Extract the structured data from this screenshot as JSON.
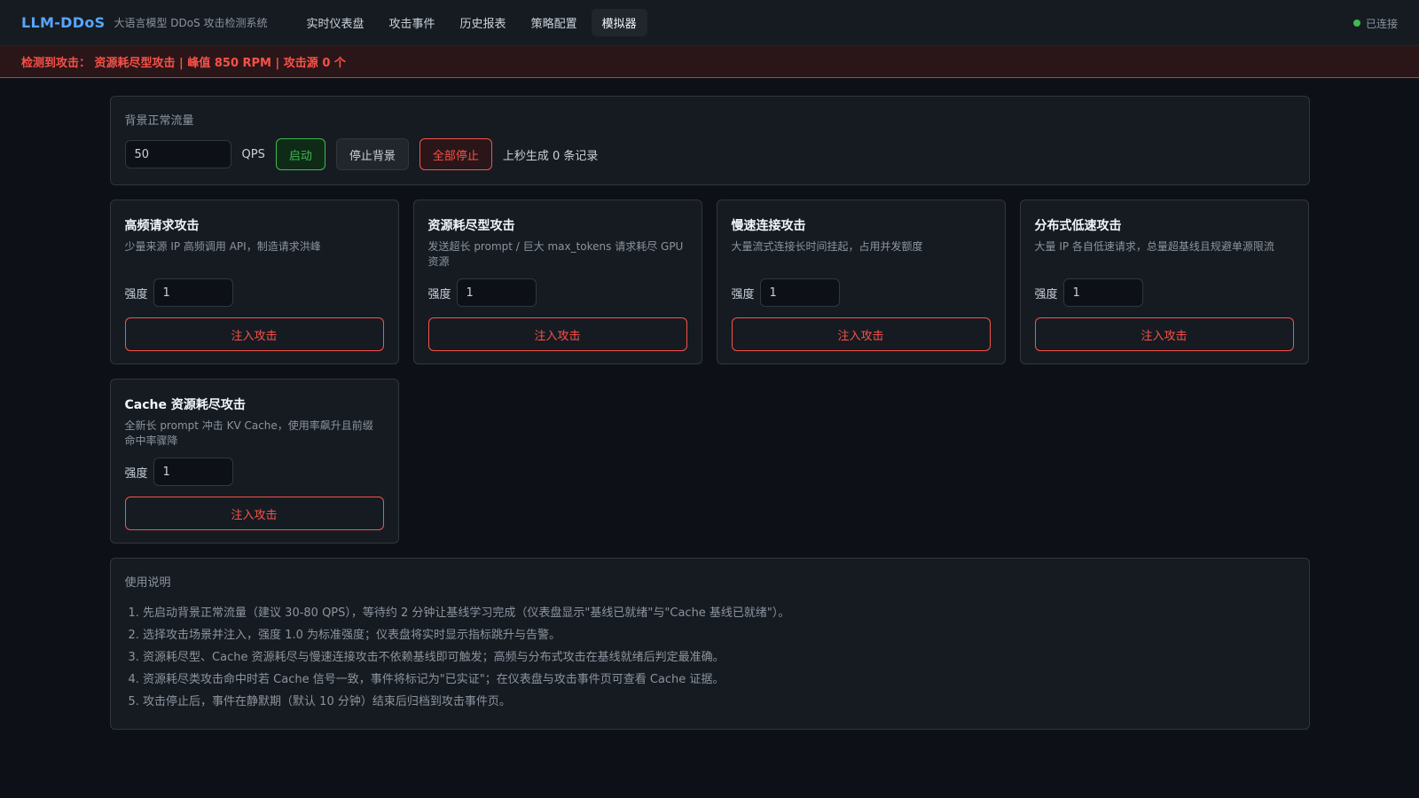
{
  "header": {
    "brand": "LLM-DDoS",
    "subtitle": "大语言模型 DDoS 攻击检测系统",
    "nav": [
      {
        "label": "实时仪表盘",
        "active": false
      },
      {
        "label": "攻击事件",
        "active": false
      },
      {
        "label": "历史报表",
        "active": false
      },
      {
        "label": "策略配置",
        "active": false
      },
      {
        "label": "模拟器",
        "active": true
      }
    ],
    "connection_status": "已连接"
  },
  "alert": {
    "text": "检测到攻击： 资源耗尽型攻击 | 峰值 850 RPM | 攻击源 0 个"
  },
  "background": {
    "title": "背景正常流量",
    "qps_value": "50",
    "qps_unit": "QPS",
    "start_label": "启动",
    "stop_bg_label": "停止背景",
    "stop_all_label": "全部停止",
    "status": "上秒生成 0 条记录"
  },
  "attacks": [
    {
      "title": "高频请求攻击",
      "desc": "少量来源 IP 高频调用 API，制造请求洪峰",
      "strength_label": "强度",
      "strength": "1",
      "inject_label": "注入攻击"
    },
    {
      "title": "资源耗尽型攻击",
      "desc": "发送超长 prompt / 巨大 max_tokens 请求耗尽 GPU 资源",
      "strength_label": "强度",
      "strength": "1",
      "inject_label": "注入攻击"
    },
    {
      "title": "慢速连接攻击",
      "desc": "大量流式连接长时间挂起，占用并发额度",
      "strength_label": "强度",
      "strength": "1",
      "inject_label": "注入攻击"
    },
    {
      "title": "分布式低速攻击",
      "desc": "大量 IP 各自低速请求，总量超基线且规避单源限流",
      "strength_label": "强度",
      "strength": "1",
      "inject_label": "注入攻击"
    },
    {
      "title": "Cache 资源耗尽攻击",
      "desc": "全新长 prompt 冲击 KV Cache，使用率飙升且前缀命中率骤降",
      "strength_label": "强度",
      "strength": "1",
      "inject_label": "注入攻击"
    }
  ],
  "help": {
    "title": "使用说明",
    "items": [
      "1. 先启动背景正常流量（建议 30-80 QPS），等待约 2 分钟让基线学习完成（仪表盘显示\"基线已就绪\"与\"Cache 基线已就绪\"）。",
      "2. 选择攻击场景并注入，强度 1.0 为标准强度；仪表盘将实时显示指标跳升与告警。",
      "3. 资源耗尽型、Cache 资源耗尽与慢速连接攻击不依赖基线即可触发；高频与分布式攻击在基线就绪后判定最准确。",
      "4. 资源耗尽类攻击命中时若 Cache 信号一致，事件将标记为\"已实证\"；在仪表盘与攻击事件页可查看 Cache 证据。",
      "5. 攻击停止后，事件在静默期（默认 10 分钟）结束后归档到攻击事件页。"
    ]
  },
  "colors": {
    "accent": "#58a6ff",
    "danger": "#f85149",
    "success": "#3fb950",
    "background": "#0d1117",
    "panel": "#161b22"
  }
}
